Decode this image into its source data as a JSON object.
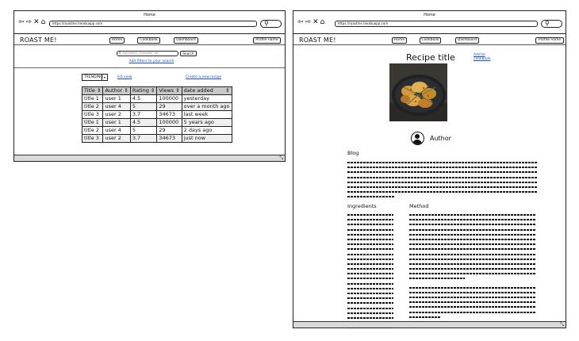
{
  "list_window": {
    "title": "Home",
    "url": "https://roastme.herokuapp.com",
    "app_name": "ROAST ME!",
    "nav": {
      "home": "Home",
      "cookbook": "Cookbook",
      "dashboard": "Dashboard",
      "profile": "Profile name"
    },
    "search": {
      "placeholder": "Ingredients, keywords, etc",
      "button": "Search",
      "filters_link": "Add filters to your search"
    },
    "sort": {
      "selected": "TRENDING",
      "arrow": "▾"
    },
    "list_view": "list view",
    "create_link": "Create a new recipe",
    "table": {
      "headers": [
        "Title ⇕",
        "Author ⇕",
        "Rating ⇕",
        "Views ⇕",
        "date added",
        "⇕"
      ],
      "rows": [
        [
          "title 1",
          "user 1",
          "4.5",
          "100000",
          "yesterday"
        ],
        [
          "title 2",
          "user 4",
          "5",
          "29",
          "over a month ago"
        ],
        [
          "title 3",
          "user 2",
          "3.7",
          "34673",
          "last week"
        ],
        [
          "title 1",
          "user 1",
          "4.5",
          "100000",
          "5 years ago"
        ],
        [
          "title 2",
          "user 4",
          "5",
          "29",
          "2 days ago"
        ],
        [
          "title 3",
          "user 2",
          "3.7",
          "34673",
          "just now"
        ]
      ]
    }
  },
  "recipe_window": {
    "title": "Home",
    "url": "https://roastme.herokuapp.com",
    "app_name": "ROAST ME!",
    "nav": {
      "home": "Home",
      "cookbook": "Cookbook",
      "dashboard": "Dashboard",
      "profile": "Profile name"
    },
    "recipe_title": "Recipe title",
    "add_to_cookbook": [
      "Add to",
      "cookbook"
    ],
    "author": "Author",
    "sections": {
      "blog": "Blog",
      "ingredients": "Ingredients",
      "method": "Method"
    }
  },
  "icons": {
    "back": "back-arrow-icon",
    "forward": "forward-arrow-icon",
    "close": "close-icon",
    "home": "home-icon",
    "search": "search-icon",
    "resize": "resize-grip-icon",
    "avatar": "user-avatar-icon",
    "sort_arrow": "sort-arrow-icon"
  }
}
